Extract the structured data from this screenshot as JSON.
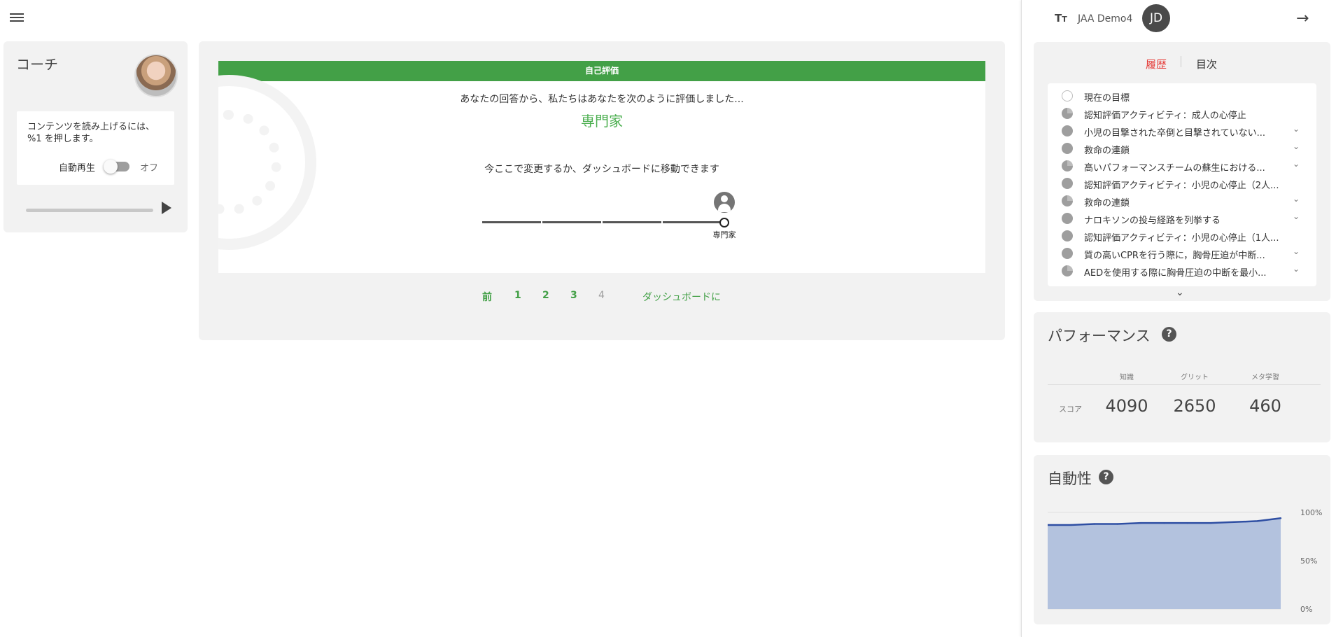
{
  "coach": {
    "title": "コーチ",
    "instruction": "コンテンツを読み上げるには、 %1 を押します。",
    "autoplay_label": "自動再生",
    "autoplay_state": "オフ",
    "autoplay_on": false
  },
  "assessment": {
    "header": "自己評価",
    "intro": "あなたの回答から、私たちはあなたを次のように評価しました...",
    "level": "専門家",
    "change_text": "今ここで変更するか、ダッシュボードに移動できます",
    "slider_label": "専門家",
    "slider_steps": 5,
    "slider_selected_index": 4
  },
  "pager": {
    "prev": "前",
    "pages": [
      "1",
      "2",
      "3",
      "4"
    ],
    "current_page": "4",
    "dashboard": "ダッシュボードに"
  },
  "sidebar": {
    "user_name": "JAA Demo4",
    "avatar_initials": "JD",
    "font_icon": "text-size-icon",
    "tabs": {
      "history": "履歴",
      "toc": "目次"
    },
    "history_items": [
      {
        "label": "現在の目標",
        "status": "empty",
        "expandable": false
      },
      {
        "label": "認知評価アクティビティ：成人の心停止",
        "status": "partial",
        "expandable": false
      },
      {
        "label": "小児の目撃された卒倒と目撃されていない...",
        "status": "full",
        "expandable": true
      },
      {
        "label": "救命の連鎖",
        "status": "full",
        "expandable": true
      },
      {
        "label": "高いパフォーマンスチームの蘇生における...",
        "status": "partial",
        "expandable": true
      },
      {
        "label": "認知評価アクティビティ：小児の心停止（2人...",
        "status": "full",
        "expandable": false
      },
      {
        "label": "救命の連鎖",
        "status": "partial",
        "expandable": true
      },
      {
        "label": "ナロキソンの投与経路を列挙する",
        "status": "full",
        "expandable": true
      },
      {
        "label": "認知評価アクティビティ：小児の心停止（1人...",
        "status": "full",
        "expandable": false
      },
      {
        "label": "質の高いCPRを行う際に，胸骨圧迫が中断...",
        "status": "full",
        "expandable": true
      },
      {
        "label": "AEDを使用する際に胸骨圧迫の中断を最小...",
        "status": "partial",
        "expandable": true
      }
    ]
  },
  "performance": {
    "title": "パフォーマンス",
    "help": "?",
    "columns": [
      "知識",
      "グリット",
      "メタ学習"
    ],
    "row_label": "スコア",
    "values": [
      "4090",
      "2650",
      "460"
    ]
  },
  "automaticity": {
    "title": "自動性",
    "help": "?",
    "fill_color": "#b3c2de",
    "line_color": "#2f4fa3"
  },
  "chart_data": {
    "type": "area",
    "title": "自動性",
    "y_tick_labels": [
      "100%",
      "50%",
      "0%"
    ],
    "ylim": [
      0,
      100
    ],
    "grid": true,
    "x": [
      0,
      10,
      20,
      30,
      40,
      50,
      60,
      70,
      80,
      90,
      100
    ],
    "values": [
      87,
      87,
      88,
      88,
      89,
      89,
      89,
      89,
      90,
      91,
      94
    ]
  }
}
